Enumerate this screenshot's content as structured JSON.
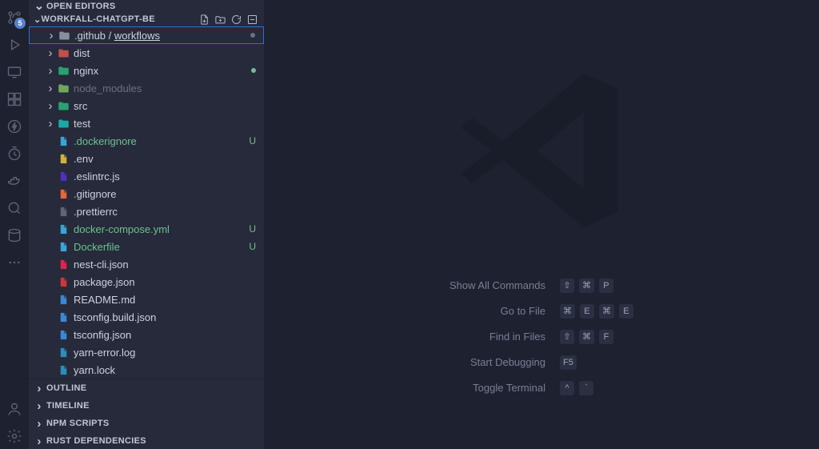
{
  "activityBadge": "5",
  "openEditorsLabel": "OPEN EDITORS",
  "projectName": "WORKFALL-CHATGPT-BE",
  "selectedPath": {
    "prefix": ".github",
    "sep": " / ",
    "leaf": "workflows"
  },
  "tree": [
    {
      "kind": "folder",
      "name": "dist",
      "color": "#c24e4e"
    },
    {
      "kind": "folder",
      "name": "nginx",
      "color": "#28a26f",
      "dotGreen": true
    },
    {
      "kind": "folder",
      "name": "node_modules",
      "dim": true,
      "color": "#6fa75e"
    },
    {
      "kind": "folder",
      "name": "src",
      "color": "#28a26f"
    },
    {
      "kind": "folder",
      "name": "test",
      "color": "#1ca9a4"
    },
    {
      "kind": "file",
      "name": ".dockerignore",
      "icon": "docker",
      "untracked": true
    },
    {
      "kind": "file",
      "name": ".env",
      "icon": "env"
    },
    {
      "kind": "file",
      "name": ".eslintrc.js",
      "icon": "eslint"
    },
    {
      "kind": "file",
      "name": ".gitignore",
      "icon": "git"
    },
    {
      "kind": "file",
      "name": ".prettierrc",
      "icon": "prettier"
    },
    {
      "kind": "file",
      "name": "docker-compose.yml",
      "icon": "docker",
      "untracked": true
    },
    {
      "kind": "file",
      "name": "Dockerfile",
      "icon": "docker",
      "untracked": true
    },
    {
      "kind": "file",
      "name": "nest-cli.json",
      "icon": "nest"
    },
    {
      "kind": "file",
      "name": "package.json",
      "icon": "npm"
    },
    {
      "kind": "file",
      "name": "README.md",
      "icon": "info"
    },
    {
      "kind": "file",
      "name": "tsconfig.build.json",
      "icon": "ts"
    },
    {
      "kind": "file",
      "name": "tsconfig.json",
      "icon": "ts"
    },
    {
      "kind": "file",
      "name": "yarn-error.log",
      "icon": "yarn"
    },
    {
      "kind": "file",
      "name": "yarn.lock",
      "icon": "yarn"
    }
  ],
  "statusU": "U",
  "bottomSections": [
    "OUTLINE",
    "TIMELINE",
    "NPM SCRIPTS",
    "RUST DEPENDENCIES"
  ],
  "shortcuts": [
    {
      "label": "Show All Commands",
      "keys": [
        "⇧",
        "⌘",
        "P"
      ]
    },
    {
      "label": "Go to File",
      "keys": [
        "⌘",
        "E",
        "⌘",
        "E"
      ]
    },
    {
      "label": "Find in Files",
      "keys": [
        "⇧",
        "⌘",
        "F"
      ]
    },
    {
      "label": "Start Debugging",
      "keys": [
        "F5"
      ]
    },
    {
      "label": "Toggle Terminal",
      "keys": [
        "^",
        "`"
      ]
    }
  ]
}
